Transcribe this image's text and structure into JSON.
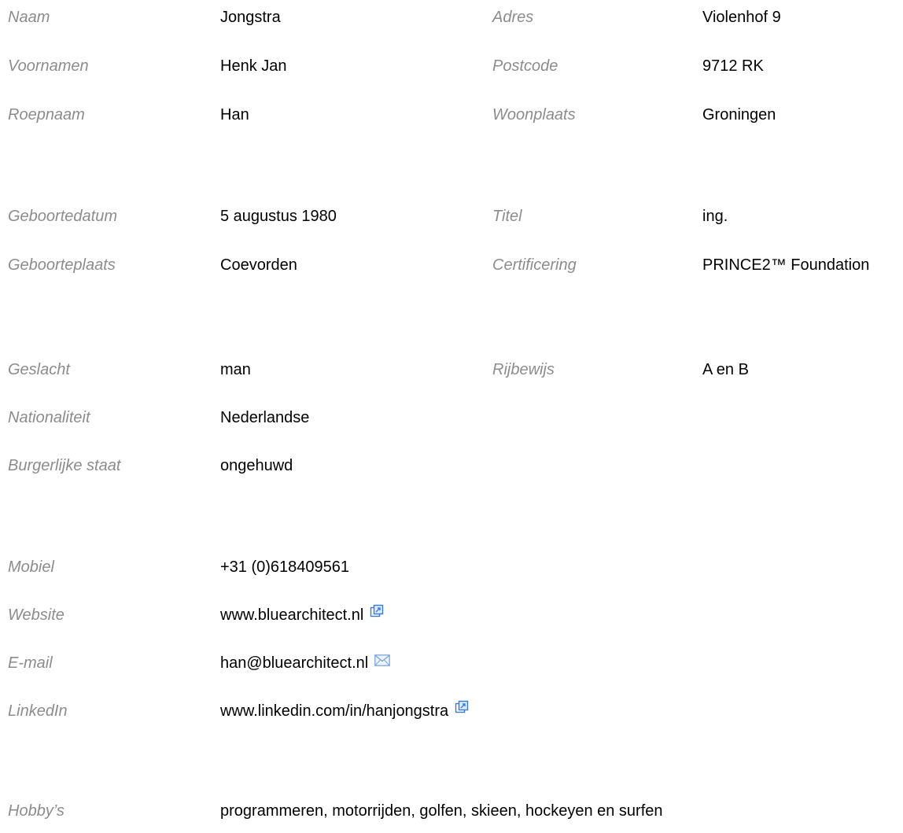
{
  "personal": {
    "naam_label": "Naam",
    "naam": "Jongstra",
    "voornamen_label": "Voornamen",
    "voornamen": "Henk Jan",
    "roepnaam_label": "Roepnaam",
    "roepnaam": "Han",
    "adres_label": "Adres",
    "adres": "Violenhof 9",
    "postcode_label": "Postcode",
    "postcode": "9712 RK",
    "woonplaats_label": "Woonplaats",
    "woonplaats": "Groningen"
  },
  "birth": {
    "geboortedatum_label": "Geboortedatum",
    "geboortedatum": "5 augustus 1980",
    "geboorteplaats_label": "Geboorteplaats",
    "geboorteplaats": "Coevorden",
    "titel_label": "Titel",
    "titel": "ing.",
    "certificering_label": "Certificering",
    "certificering": "PRINCE2™ Foundation"
  },
  "status": {
    "geslacht_label": "Geslacht",
    "geslacht": "man",
    "nationaliteit_label": "Nationaliteit",
    "nationaliteit": "Nederlandse",
    "burgerlijke_staat_label": "Burgerlijke staat",
    "burgerlijke_staat": "ongehuwd",
    "rijbewijs_label": "Rijbewijs",
    "rijbewijs": "A en B"
  },
  "contact": {
    "mobiel_label": "Mobiel",
    "mobiel": "+31 (0)618409561",
    "website_label": "Website",
    "website": "www.bluearchitect.nl",
    "website_icon": "external-link-icon",
    "email_label": "E-mail",
    "email": "han@bluearchitect.nl",
    "email_icon": "envelope-icon",
    "linkedin_label": "LinkedIn",
    "linkedin": "www.linkedin.com/in/hanjongstra",
    "linkedin_icon": "external-link-icon"
  },
  "hobbies": {
    "label": "Hobby’s",
    "value": "programmeren, motorrijden, golfen, skieen, hockeyen en surfen"
  },
  "colors": {
    "label_gray": "#8c8c8c",
    "text": "#000000",
    "icon_blue": "#3a7bd5"
  }
}
